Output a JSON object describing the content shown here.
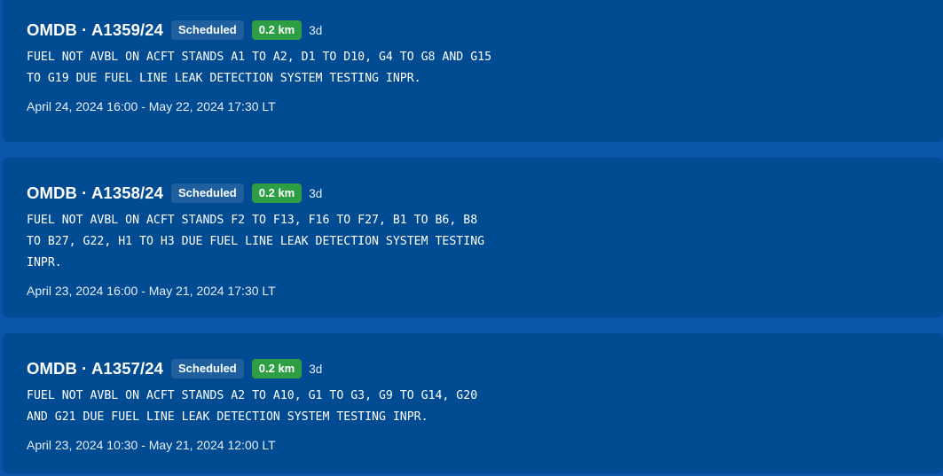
{
  "notams": [
    {
      "title": "OMDB · A1359/24",
      "status": "Scheduled",
      "distance": "0.2 km",
      "age": "3d",
      "text": "FUEL NOT AVBL ON ACFT STANDS A1 TO A2, D1 TO D10, G4 TO G8 AND G15\nTO G19 DUE FUEL LINE LEAK DETECTION SYSTEM TESTING INPR.",
      "validity": "April 24, 2024 16:00 - May 22, 2024 17:30 LT"
    },
    {
      "title": "OMDB · A1358/24",
      "status": "Scheduled",
      "distance": "0.2 km",
      "age": "3d",
      "text": "FUEL NOT AVBL ON ACFT STANDS F2 TO F13, F16 TO F27, B1 TO B6, B8\nTO B27, G22, H1 TO H3 DUE FUEL LINE LEAK DETECTION SYSTEM TESTING\nINPR.",
      "validity": "April 23, 2024 16:00 - May 21, 2024 17:30 LT"
    },
    {
      "title": "OMDB · A1357/24",
      "status": "Scheduled",
      "distance": "0.2 km",
      "age": "3d",
      "text": "FUEL NOT AVBL ON ACFT STANDS A2 TO A10, G1 TO G3, G9 TO G14, G20\nAND G21 DUE FUEL LINE LEAK DETECTION SYSTEM TESTING INPR.",
      "validity": "April 23, 2024 10:30 - May 21, 2024 12:00 LT"
    }
  ],
  "colors": {
    "background": "#0a55a8",
    "card": "#004b91",
    "status_badge": "#1f5f9e",
    "distance_badge": "#2e9e44"
  }
}
